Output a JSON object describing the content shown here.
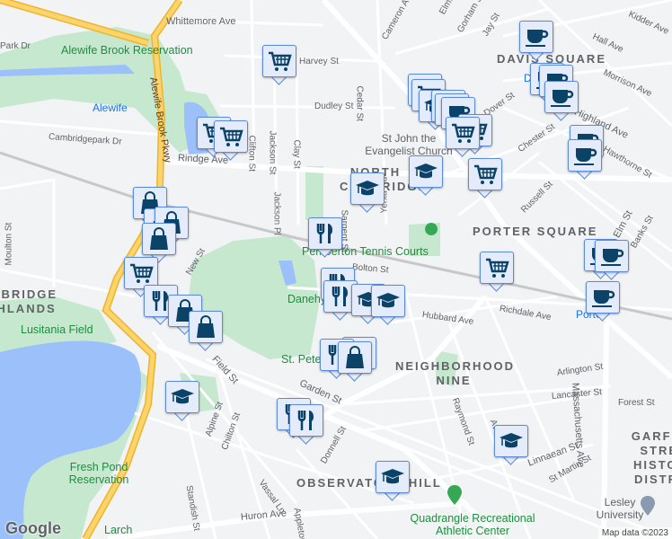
{
  "colors": {
    "marker_fill": "#e4ecfc",
    "marker_border": "#5b8ad8",
    "marker_icon": "#0b4268",
    "park": "#c6e8cf",
    "water": "#9cc0f9",
    "highway": "#fbd46d"
  },
  "streets": [
    "Whittemore Ave",
    "Cameron Ave",
    "Elmwood St",
    "Gorham St",
    "Jay St",
    "Kidder Ave",
    "Hall Ave",
    "Morrison Ave",
    "Park Dr",
    "Harvey St",
    "Dudley St",
    "Cambridgepark Dr",
    "Rindge Ave",
    "Alewife Brook Pkwy",
    "Clifton St",
    "Jackson St",
    "Clay St",
    "Cedar St",
    "Jackson Pl",
    "Sargent St",
    "Yerxa Rd",
    "Dover St",
    "Chester St",
    "Russell St",
    "Hawthorne St",
    "Elm St",
    "Banks St",
    "Moulton St",
    "New St",
    "Bolton St",
    "Hubbard Ave",
    "Richdale Ave",
    "Field St",
    "Garden St",
    "Alpine St",
    "Chilton St",
    "Standish St",
    "Vassal Ln",
    "Huron Ave",
    "Donnell St",
    "Raymond St",
    "Avon St",
    "Arlington St",
    "Lancaster St",
    "Forest St",
    "Linnaean St",
    "St Martin St",
    "Massachusetts Ave",
    "Highland Ave",
    "Appleton St"
  ],
  "places": {
    "alewife_res": "Alewife Brook Reservation",
    "alewife_station": "Alewife",
    "davis": "DAVIS SQUARE",
    "st_john": "St John the Evangelist Church",
    "north_cambridge": "NORTH CAMBRIDGE",
    "porter": "PORTER SQUARE",
    "pemberton": "Pemberton Tennis Courts",
    "cambridge_highlands": "CAMBRIDGE HIGHLANDS",
    "lusitania": "Lusitania Field",
    "danehy": "Danehy Park",
    "st_peter": "St. Peter",
    "neighborhood_nine": "NEIGHBORHOOD NINE",
    "fresh_pond": "Fresh Pond Reservation",
    "observatory": "OBSERVATORY HILL",
    "garfield": "GARFIELD STREET HISTORIC DISTRICT",
    "lesley": "Lesley University",
    "quadrangle": "Quadrangle Recreational Athletic Center",
    "larch": "Larch",
    "porter_station": "Porter",
    "davis_station": "Davis"
  },
  "markers": [
    "cart-icon",
    "cart-icon",
    "cart-icon",
    "coffee-icon",
    "coffee-icon",
    "coffee-icon",
    "coffee-icon",
    "cart-icon",
    "cart-icon",
    "graduation-cap-icon",
    "coffee-icon",
    "coffee-icon",
    "coffee-icon",
    "cart-icon",
    "cart-icon",
    "graduation-cap-icon",
    "graduation-cap-icon",
    "cart-icon",
    "coffee-icon",
    "coffee-icon",
    "fork-knife-icon",
    "shopping-bag-icon",
    "shopping-bag-icon",
    "shopping-bag-icon",
    "shopping-bag-icon",
    "coffee-icon",
    "coffee-icon",
    "cart-icon",
    "cart-icon",
    "fork-knife-icon",
    "shopping-bag-icon",
    "shopping-bag-icon",
    "fork-knife-icon",
    "fork-knife-icon",
    "graduation-cap-icon",
    "graduation-cap-icon",
    "shopping-bag-icon",
    "fork-knife-icon",
    "shopping-bag-icon",
    "graduation-cap-icon",
    "fork-knife-icon",
    "fork-knife-icon",
    "graduation-cap-icon",
    "graduation-cap-icon",
    "coffee-icon"
  ],
  "footer": {
    "logo": "Google",
    "attribution": "Map data ©2023"
  }
}
